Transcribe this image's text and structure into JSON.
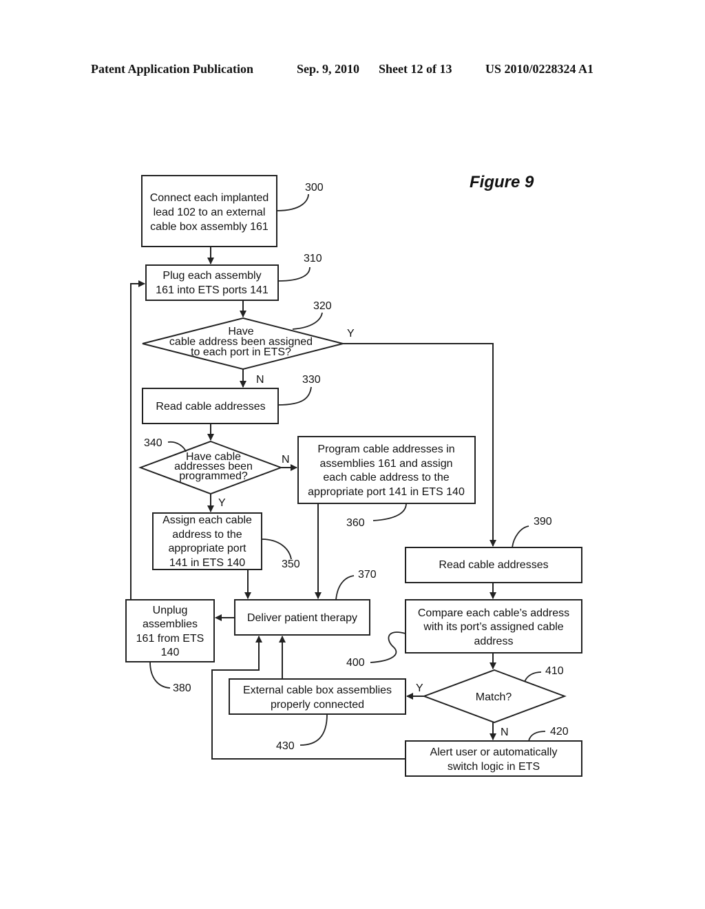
{
  "header": {
    "publication": "Patent Application Publication",
    "date": "Sep. 9, 2010",
    "sheet": "Sheet 12 of 13",
    "number": "US 2010/0228324 A1"
  },
  "figure_title": "Figure 9",
  "nodes": {
    "n300": {
      "ref": "300",
      "lines": [
        "Connect each implanted",
        "lead 102 to an external",
        "cable box assembly 161"
      ]
    },
    "n310": {
      "ref": "310",
      "lines": [
        "Plug each assembly",
        "161 into ETS ports 141"
      ]
    },
    "n320": {
      "ref": "320",
      "lines": [
        "Have",
        "cable address been assigned",
        "to each port in ETS?"
      ]
    },
    "n330": {
      "ref": "330",
      "lines": [
        "Read cable addresses"
      ]
    },
    "n340": {
      "ref": "340",
      "lines": [
        "Have cable",
        "addresses been",
        "programmed?"
      ]
    },
    "n350": {
      "ref": "350",
      "lines": [
        "Assign each cable",
        "address to the",
        "appropriate port",
        "141 in ETS 140"
      ]
    },
    "n360": {
      "ref": "360",
      "lines": [
        "Program cable addresses in",
        "assemblies 161 and assign",
        "each cable address to the",
        "appropriate port 141 in ETS 140"
      ]
    },
    "n370": {
      "ref": "370",
      "lines": [
        "Deliver patient therapy"
      ]
    },
    "n380": {
      "ref": "380",
      "lines": [
        "Unplug",
        "assemblies",
        "161 from ETS",
        "140"
      ]
    },
    "n390": {
      "ref": "390",
      "lines": [
        "Read cable addresses"
      ]
    },
    "n400": {
      "ref": "400",
      "lines": [
        "Compare each cable’s address",
        "with its port’s assigned cable",
        "address"
      ]
    },
    "n410": {
      "ref": "410",
      "lines": [
        "Match?"
      ]
    },
    "n420": {
      "ref": "420",
      "lines": [
        "Alert user or automatically",
        "switch logic in ETS"
      ]
    },
    "n430": {
      "ref": "430",
      "lines": [
        "External cable box assemblies",
        "properly connected"
      ]
    }
  },
  "edge_labels": {
    "e320_yes": "Y",
    "e320_no": "N",
    "e340_no": "N",
    "e340_yes": "Y",
    "e410_yes": "Y",
    "e410_no": "N"
  }
}
